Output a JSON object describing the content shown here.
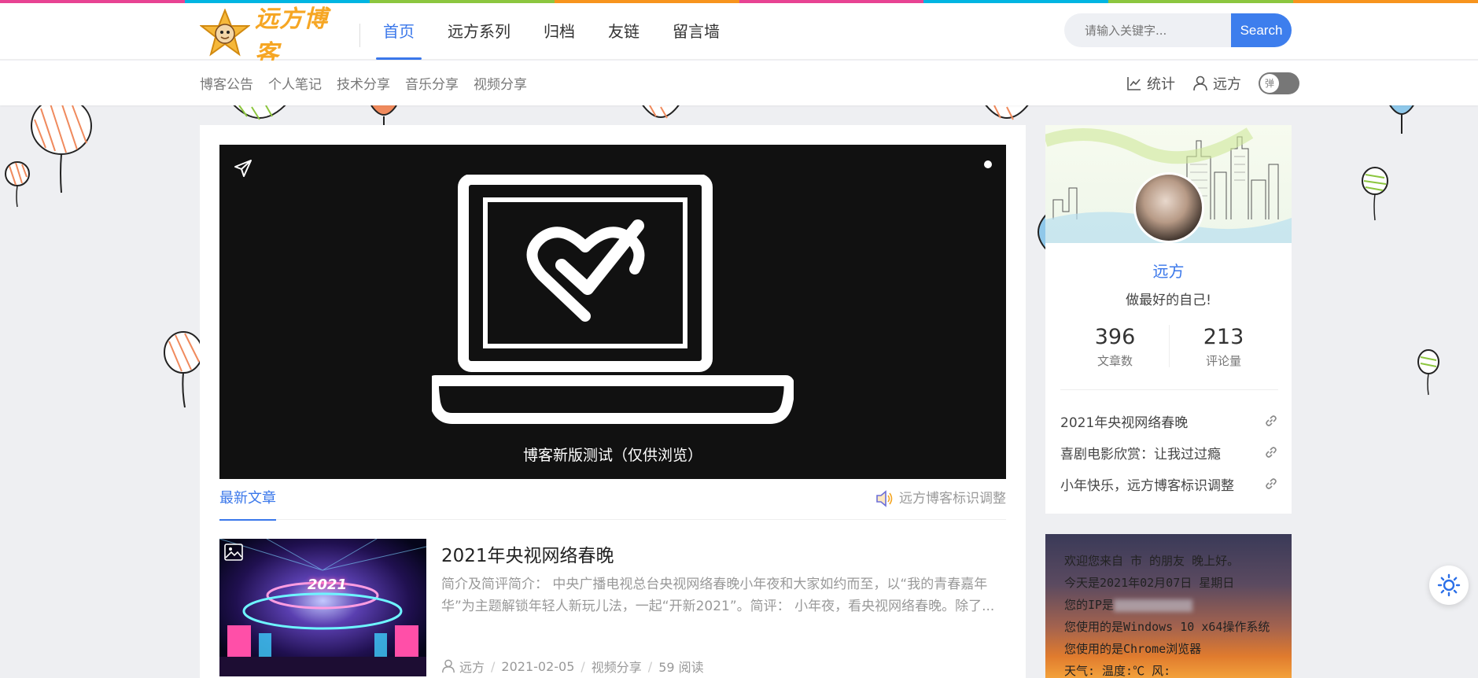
{
  "header": {
    "logo_text": "远方博客",
    "nav": [
      "首页",
      "远方系列",
      "归档",
      "友链",
      "留言墙"
    ],
    "active_nav_index": 0,
    "search": {
      "placeholder": "请输入关键字...",
      "button_label": "Search"
    }
  },
  "subnav": {
    "items": [
      "博客公告",
      "个人笔记",
      "技术分享",
      "音乐分享",
      "视频分享"
    ],
    "tools": {
      "stats_label": "统计",
      "user_label": "远方",
      "toggle_label": "弹"
    }
  },
  "banner": {
    "caption": "博客新版测试（仅供浏览）"
  },
  "tabs": {
    "latest_label": "最新文章",
    "notice_text": "远方博客标识调整"
  },
  "article": {
    "title": "2021年央视网络春晚",
    "summary": "简介及简评简介： 中央广播电视总台央视网络春晚小年夜和大家如约而至，以“我的青春嘉年华”为主题解锁年轻人新玩儿法，一起“开新2021”。简评： 小年夜，看央视网络春晚。除了...",
    "thumb_text": "2021",
    "meta": {
      "author": "远方",
      "date": "2021-02-05",
      "category": "视频分享",
      "reads": "59 阅读"
    }
  },
  "profile": {
    "name": "远方",
    "motto": "做最好的自己!",
    "stats": [
      {
        "value": "396",
        "label": "文章数"
      },
      {
        "value": "213",
        "label": "评论量"
      }
    ],
    "links": [
      "2021年央视网络春晚",
      "喜剧电影欣赏：让我过过瘾",
      "小年快乐，远方博客标识调整"
    ]
  },
  "welcome": {
    "lines": [
      "欢迎您来自 市 的朋友  晚上好。",
      "今天是2021年02月07日  星期日",
      "您的IP是",
      "您使用的是Windows 10 x64操作系统",
      "您使用的是Chrome浏览器",
      "天气:  温度:℃  风:"
    ]
  },
  "colors": {
    "accent": "#3a77ea",
    "logo": "#f6a623"
  }
}
